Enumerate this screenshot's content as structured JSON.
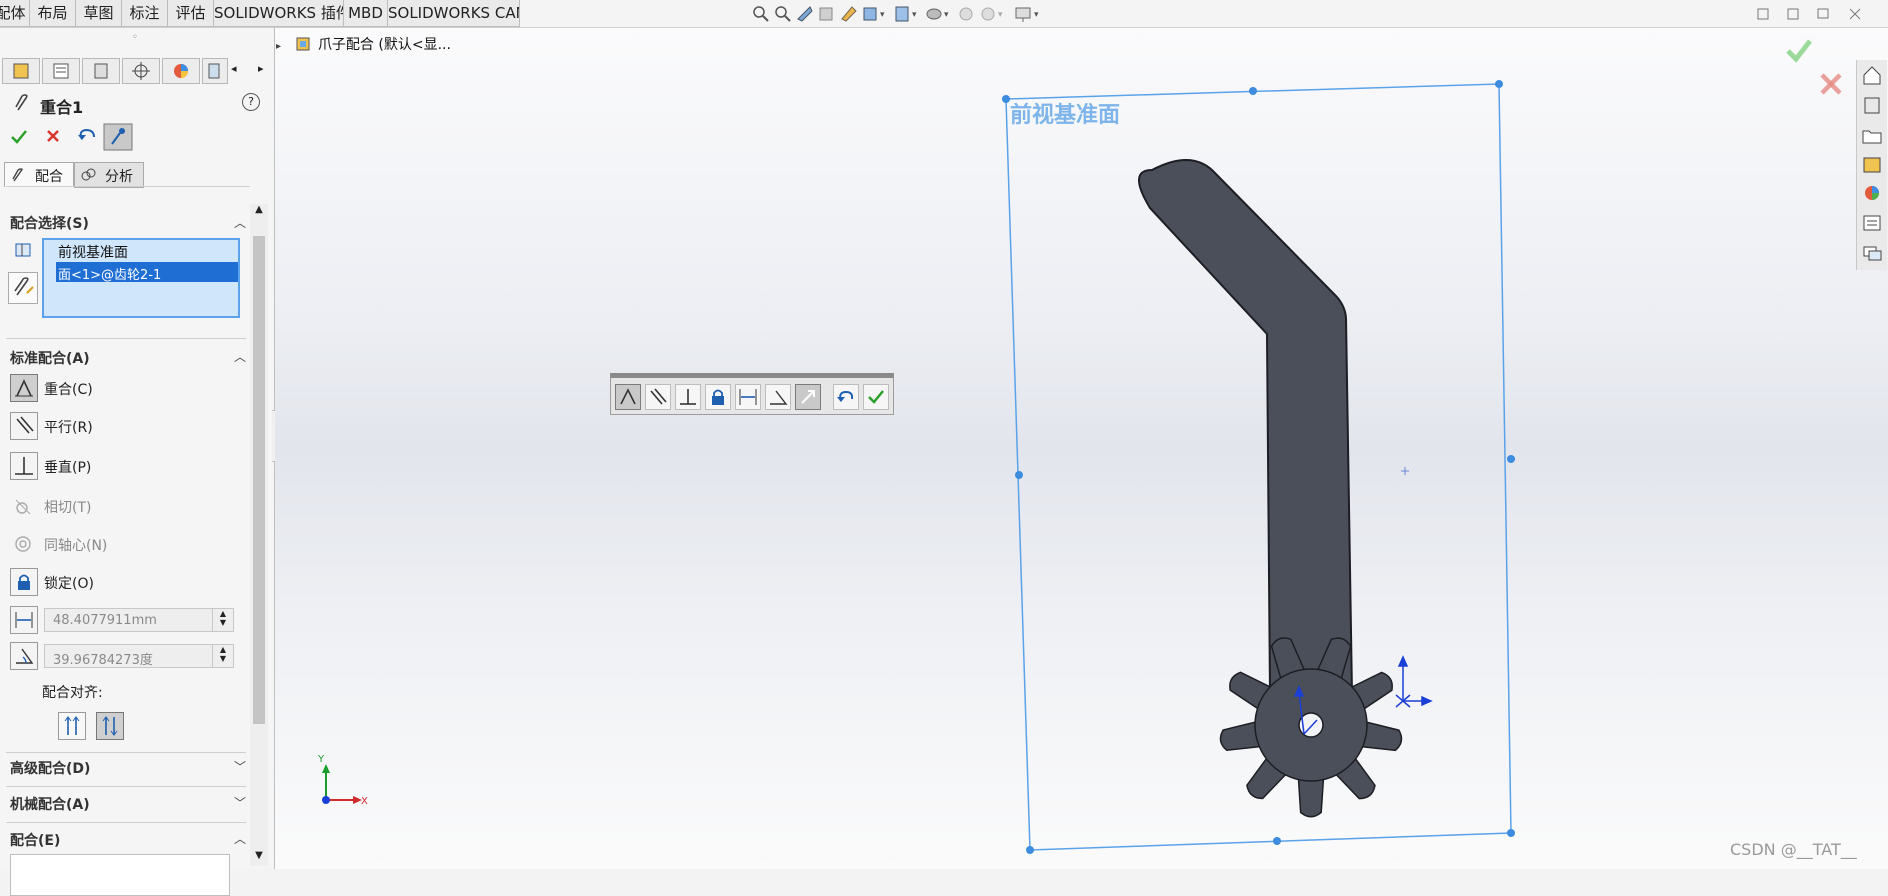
{
  "ribbon": {
    "tabs": [
      "配体",
      "布局",
      "草图",
      "标注",
      "评估",
      "SOLIDWORKS 插件",
      "MBD",
      "SOLIDWORKS CAM"
    ]
  },
  "tree": {
    "root_label": "爪子配合 (默认<显..."
  },
  "property_manager": {
    "title": "重合1",
    "help": "?",
    "tabs": {
      "mates": "配合",
      "analysis": "分析"
    },
    "mate_selections": {
      "title": "配合选择(S)",
      "items": [
        "前视基准面",
        "面<1>@齿轮2-1"
      ]
    },
    "standard_mates": {
      "title": "标准配合(A)",
      "items": [
        "重合(C)",
        "平行(R)",
        "垂直(P)",
        "相切(T)",
        "同轴心(N)",
        "锁定(O)"
      ],
      "distance_value": "48.4077911mm",
      "angle_value": "39.96784273度",
      "alignment_label": "配合对齐:"
    },
    "advanced_title": "高级配合(D)",
    "mechanical_title": "机械配合(A)",
    "mates_title": "配合(E)"
  },
  "viewport": {
    "plane_label": "前视基准面",
    "triad": {
      "y": "Y",
      "x": "X"
    }
  },
  "watermark": "CSDN @__TAT__",
  "colors": {
    "accent_blue": "#3d8ce0",
    "part_fill": "#4b4f59",
    "plane_line": "#5aa2ea",
    "ok_green": "#2ca02c",
    "cancel_red": "#d9342b"
  }
}
